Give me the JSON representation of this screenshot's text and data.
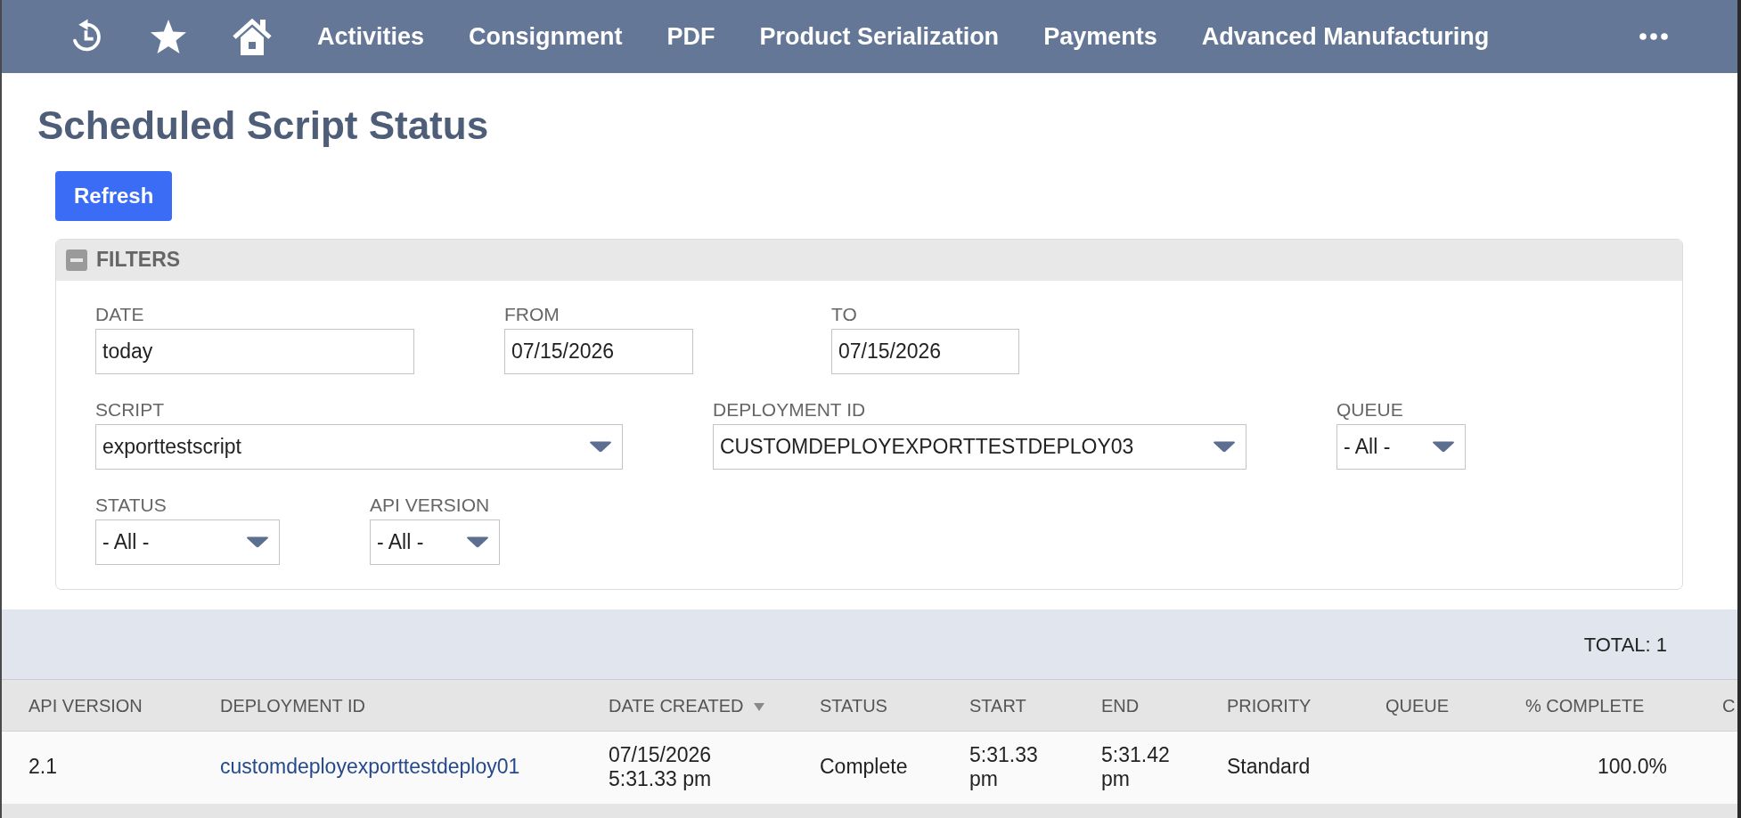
{
  "nav": {
    "items": [
      "Activities",
      "Consignment",
      "PDF",
      "Product Serialization",
      "Payments",
      "Advanced Manufacturing"
    ]
  },
  "page": {
    "title": "Scheduled Script Status",
    "refresh_button": "Refresh"
  },
  "filters": {
    "title": "FILTERS",
    "expanded": true,
    "lines": [
      {
        "fields": [
          {
            "label": "DATE",
            "kind": "text",
            "value": "today"
          },
          {
            "label": "FROM",
            "kind": "text",
            "value": "07/15/2026"
          },
          {
            "label": "TO",
            "kind": "text",
            "value": "07/15/2026"
          }
        ]
      },
      {
        "fields": [
          {
            "label": "SCRIPT",
            "kind": "select",
            "value": "exporttestscript"
          },
          {
            "label": "DEPLOYMENT ID",
            "kind": "select",
            "value": "CUSTOMDEPLOYEXPORTTESTDEPLOY03"
          },
          {
            "label": "QUEUE",
            "kind": "select",
            "value": "- All -"
          }
        ]
      },
      {
        "fields": [
          {
            "label": "STATUS",
            "kind": "select",
            "value": "- All -"
          },
          {
            "label": "API VERSION",
            "kind": "select",
            "value": "- All -"
          }
        ]
      }
    ]
  },
  "results": {
    "total": "TOTAL: 1",
    "columns": [
      {
        "label": "API VERSION",
        "kind": "text",
        "sorted": false
      },
      {
        "label": "DEPLOYMENT ID",
        "kind": "link",
        "sorted": false
      },
      {
        "label": "DATE CREATED",
        "kind": "text",
        "sorted": true
      },
      {
        "label": "STATUS",
        "kind": "text",
        "sorted": false
      },
      {
        "label": "START",
        "kind": "text",
        "sorted": false
      },
      {
        "label": "END",
        "kind": "text",
        "sorted": false
      },
      {
        "label": "PRIORITY",
        "kind": "text",
        "sorted": false
      },
      {
        "label": "QUEUE",
        "sorted": false
      },
      {
        "label": "% COMPLETE",
        "kind": "number",
        "sorted": false
      },
      {
        "label": "C"
      }
    ],
    "rows": [
      {
        "api_version": "2.1",
        "deployment_id": "customdeployexporttestdeploy01",
        "date_created": "07/15/2026 5:31.33 pm",
        "status": "Complete",
        "start": "5:31.33 pm",
        "end": "5:31.42 pm",
        "priority": "Standard",
        "percent_complete": "100.0%"
      }
    ]
  }
}
